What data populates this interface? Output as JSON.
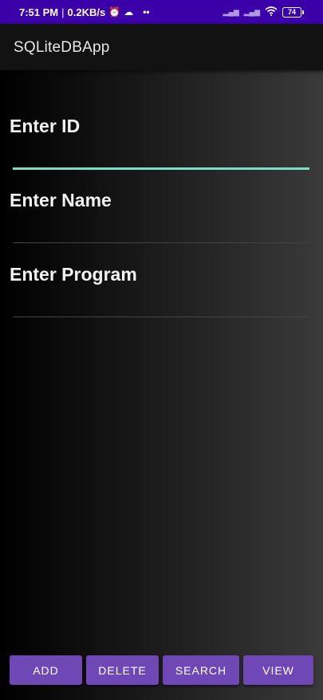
{
  "status_bar": {
    "time": "7:51 PM",
    "separator": "|",
    "speed": "0.2KB/s",
    "alarm_icon": "⏰",
    "notif_icon": "☁",
    "dots": "••",
    "signal1": "▂▄▆",
    "signal2": "▂▄▆",
    "wifi_icon": "◠",
    "battery": "74",
    "background": "#3b00a8"
  },
  "app_bar": {
    "title": "SQLiteDBApp"
  },
  "form": {
    "id_label": "Enter ID",
    "name_label": "Enter Name",
    "program_label": "Enter Program",
    "focus_color": "#7fdcc3"
  },
  "buttons": {
    "add": "ADD",
    "delete": "DELETE",
    "search": "SEARCH",
    "view": "VIEW",
    "color": "#7048b6"
  }
}
